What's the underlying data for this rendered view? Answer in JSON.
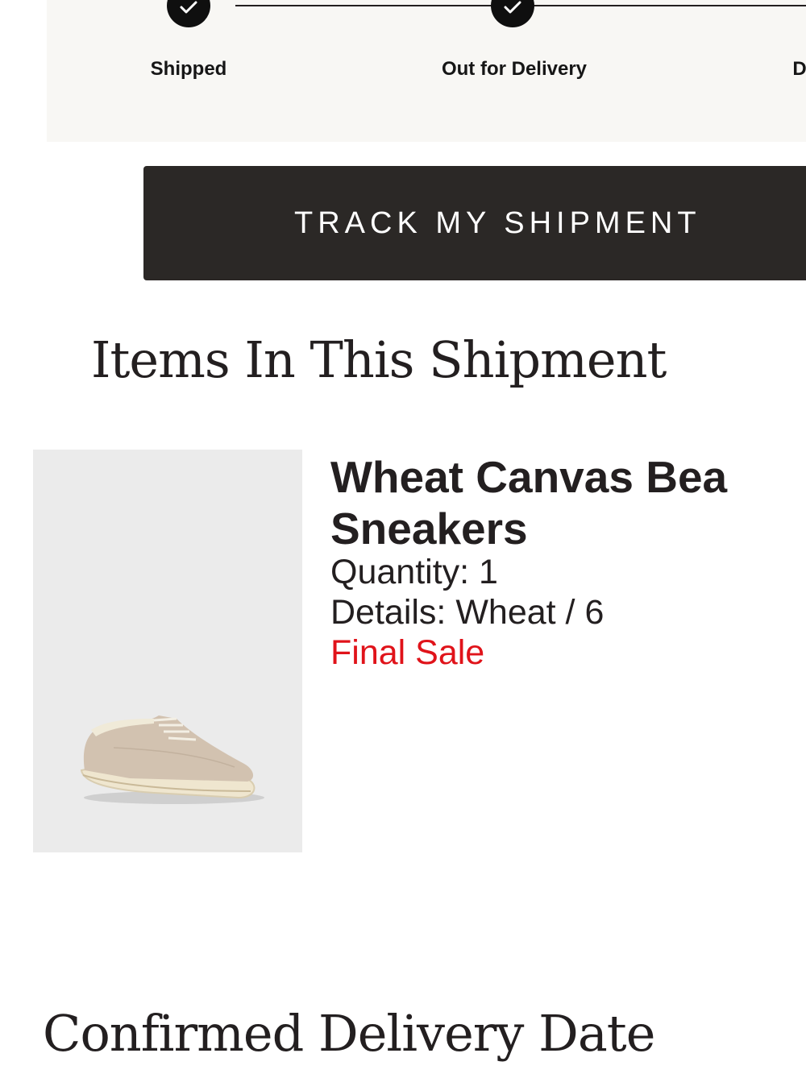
{
  "tracker": {
    "steps": [
      {
        "label": "Shipped",
        "completed": true
      },
      {
        "label": "Out for Delivery",
        "completed": true
      },
      {
        "label": "D",
        "completed": false
      }
    ]
  },
  "actions": {
    "track_label": "TRACK MY SHIPMENT"
  },
  "items_section": {
    "title": "Items In This Shipment",
    "items": [
      {
        "name_line1": "Wheat Canvas Bea",
        "name_line2": "Sneakers",
        "quantity": "Quantity: 1",
        "details": "Details: Wheat / 6",
        "badge": "Final Sale",
        "image_icon": "sneaker-image"
      }
    ]
  },
  "delivery_section": {
    "title": "Confirmed Delivery Date"
  },
  "colors": {
    "accent": "#2b2826",
    "sale": "#e0131a",
    "panel": "#f8f7f4"
  }
}
